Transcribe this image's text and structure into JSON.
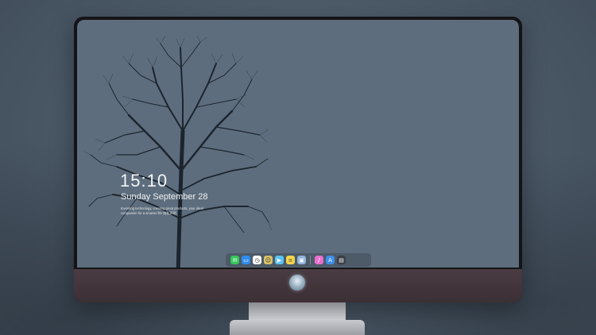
{
  "lockscreen": {
    "time": "15:10",
    "date": "Sunday September 28",
    "tagline": "Inventing technology, creating great products, your ideal companion for a smarter life 隐私声明"
  },
  "dock": {
    "apps": [
      {
        "name": "messages-icon",
        "color": "#35c759",
        "glyph": "✉"
      },
      {
        "name": "files-icon",
        "color": "#2f8cf0",
        "glyph": "▭"
      },
      {
        "name": "clock-icon",
        "color": "#ffffff",
        "glyph": "◷"
      },
      {
        "name": "finder-icon",
        "color": "#d9c36a",
        "glyph": "☺"
      },
      {
        "name": "video-icon",
        "color": "#5cc2f2",
        "glyph": "▶"
      },
      {
        "name": "notes-icon",
        "color": "#f7d54a",
        "glyph": "≡"
      },
      {
        "name": "photos-icon",
        "color": "#8fb3d9",
        "glyph": "▣"
      },
      {
        "name": "music-icon",
        "color": "#e86fd0",
        "glyph": "♪"
      },
      {
        "name": "appstore-icon",
        "color": "#3f8fe8",
        "glyph": "A"
      },
      {
        "name": "calendar-icon",
        "color": "#3a3f46",
        "glyph": "▤"
      }
    ]
  }
}
